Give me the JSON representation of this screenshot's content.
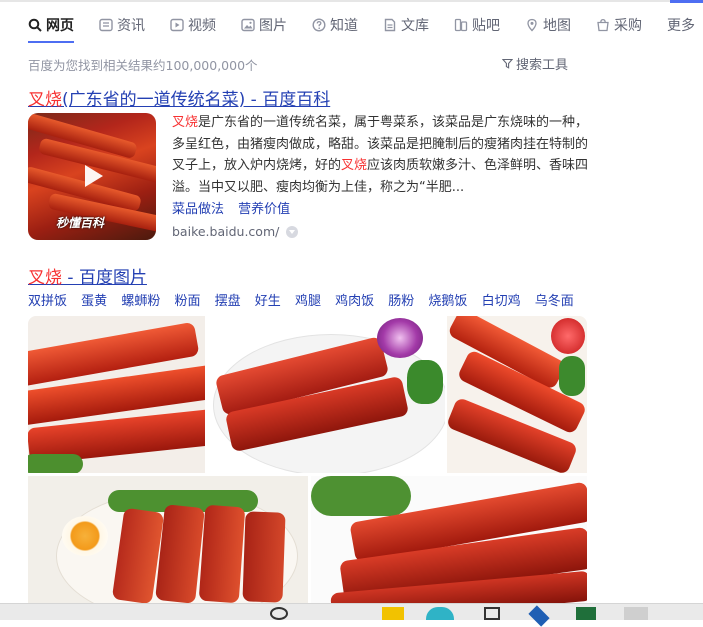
{
  "nav": {
    "tabs": [
      {
        "label": "网页",
        "icon": "search-icon",
        "active": true
      },
      {
        "label": "资讯",
        "icon": "news-icon"
      },
      {
        "label": "视频",
        "icon": "video-icon"
      },
      {
        "label": "图片",
        "icon": "image-icon"
      },
      {
        "label": "知道",
        "icon": "question-icon"
      },
      {
        "label": "文库",
        "icon": "document-icon"
      },
      {
        "label": "贴吧",
        "icon": "tieba-icon"
      },
      {
        "label": "地图",
        "icon": "map-icon"
      },
      {
        "label": "采购",
        "icon": "shopping-icon"
      },
      {
        "label": "更多",
        "icon": ""
      }
    ]
  },
  "results_info": {
    "count_text": "百度为您找到相关结果约100,000,000个",
    "tools_label": "搜索工具"
  },
  "result1": {
    "title_keyword": "叉烧",
    "title_rest": "(广东省的一道传统名菜) - 百度百科",
    "thumb_logo": "秒懂百科",
    "abstract_segments": [
      {
        "text": "叉烧",
        "highlight": true
      },
      {
        "text": "是广东省的一道传统名菜，属于粤菜系，该菜品是广东烧味的一种，多呈红色，由猪瘦肉做成，略甜。该菜品是把腌制后的瘦猪肉挂在特制的叉子上，放入炉内烧烤，好的",
        "highlight": false
      },
      {
        "text": "叉烧",
        "highlight": true
      },
      {
        "text": "应该肉质软嫩多汁、色泽鲜明、香味四溢。当中又以肥、瘦肉均衡为上佳，称之为“半肥...",
        "highlight": false
      }
    ],
    "sublinks": [
      "菜品做法",
      "营养价值"
    ],
    "source": "baike.baidu.com/"
  },
  "result2": {
    "title_keyword": "叉烧",
    "title_rest": " - 百度图片",
    "tags": [
      "双拼饭",
      "蛋黄",
      "螺蛳粉",
      "粉面",
      "摆盘",
      "好生",
      "鸡腿",
      "鸡肉饭",
      "肠粉",
      "烧鹅饭",
      "白切鸡",
      "乌冬面"
    ]
  },
  "colors": {
    "link": "#2440b3",
    "highlight": "#f73131",
    "accent": "#4e6ef2",
    "muted": "#9195a3"
  }
}
